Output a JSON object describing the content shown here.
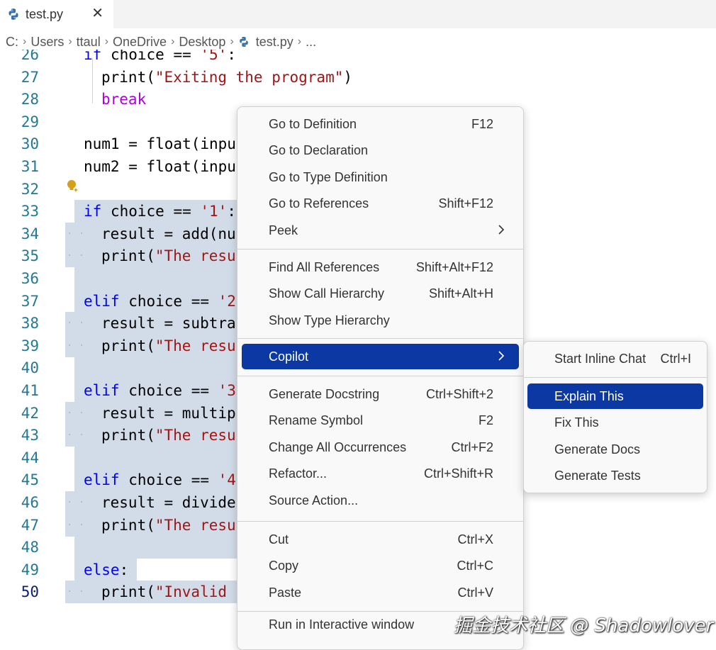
{
  "tab": {
    "title": "test.py",
    "close_glyph": "✕",
    "icon": "python-file-icon"
  },
  "breadcrumb": {
    "items": [
      "C:",
      "Users",
      "ttaul",
      "OneDrive",
      "Desktop",
      "test.py",
      "..."
    ],
    "separator": "›"
  },
  "editor": {
    "lines": [
      {
        "num": "26",
        "code": "if choice == '5':"
      },
      {
        "num": "27",
        "code": "print(\"Exiting the program\")"
      },
      {
        "num": "28",
        "code": "break"
      },
      {
        "num": "29",
        "code": ""
      },
      {
        "num": "30",
        "code": "num1 = float(inpu"
      },
      {
        "num": "31",
        "code": "num2 = float(inpu"
      },
      {
        "num": "32",
        "code": ""
      },
      {
        "num": "33",
        "code": "if choice == '1':"
      },
      {
        "num": "34",
        "code": "result = add(nu"
      },
      {
        "num": "35",
        "code": "print(\"The resu"
      },
      {
        "num": "36",
        "code": ""
      },
      {
        "num": "37",
        "code": "elif choice == '2"
      },
      {
        "num": "38",
        "code": "result = subtra"
      },
      {
        "num": "39",
        "code": "print(\"The resu"
      },
      {
        "num": "40",
        "code": ""
      },
      {
        "num": "41",
        "code": "elif choice == '3"
      },
      {
        "num": "42",
        "code": "result = multip"
      },
      {
        "num": "43",
        "code": "print(\"The resu"
      },
      {
        "num": "44",
        "code": ""
      },
      {
        "num": "45",
        "code": "elif choice == '4"
      },
      {
        "num": "46",
        "code": "result = divide"
      },
      {
        "num": "47",
        "code": "print(\"The resu"
      },
      {
        "num": "48",
        "code": ""
      },
      {
        "num": "49",
        "code": "else:"
      },
      {
        "num": "50",
        "code": "print(\"Invalid"
      }
    ],
    "accent_selection": "#d2dce8",
    "lightbulb_icon": "lightbulb-sparkle-icon"
  },
  "context_menu": {
    "groups": [
      [
        {
          "label": "Go to Definition",
          "key": "F12"
        },
        {
          "label": "Go to Declaration",
          "key": ""
        },
        {
          "label": "Go to Type Definition",
          "key": ""
        },
        {
          "label": "Go to References",
          "key": "Shift+F12"
        },
        {
          "label": "Peek",
          "key": "",
          "submenu": true
        }
      ],
      [
        {
          "label": "Find All References",
          "key": "Shift+Alt+F12"
        },
        {
          "label": "Show Call Hierarchy",
          "key": "Shift+Alt+H"
        },
        {
          "label": "Show Type Hierarchy",
          "key": ""
        }
      ],
      [
        {
          "label": "Copilot",
          "key": "",
          "submenu": true,
          "highlighted": true
        }
      ],
      [
        {
          "label": "Generate Docstring",
          "key": "Ctrl+Shift+2"
        },
        {
          "label": "Rename Symbol",
          "key": "F2"
        },
        {
          "label": "Change All Occurrences",
          "key": "Ctrl+F2"
        },
        {
          "label": "Refactor...",
          "key": "Ctrl+Shift+R"
        },
        {
          "label": "Source Action...",
          "key": ""
        }
      ],
      [
        {
          "label": "Cut",
          "key": "Ctrl+X"
        },
        {
          "label": "Copy",
          "key": "Ctrl+C"
        },
        {
          "label": "Paste",
          "key": "Ctrl+V"
        }
      ],
      [
        {
          "label": "Run in Interactive window",
          "key": ""
        }
      ]
    ],
    "highlight_color": "#0b38a3"
  },
  "copilot_submenu": {
    "items": [
      {
        "label": "Start Inline Chat",
        "key": "Ctrl+I"
      },
      {
        "label": "Explain This",
        "key": "",
        "highlighted": true
      },
      {
        "label": "Fix This",
        "key": ""
      },
      {
        "label": "Generate Docs",
        "key": ""
      },
      {
        "label": "Generate Tests",
        "key": ""
      }
    ]
  },
  "watermark": "掘金技术社区 @ Shadowlover"
}
